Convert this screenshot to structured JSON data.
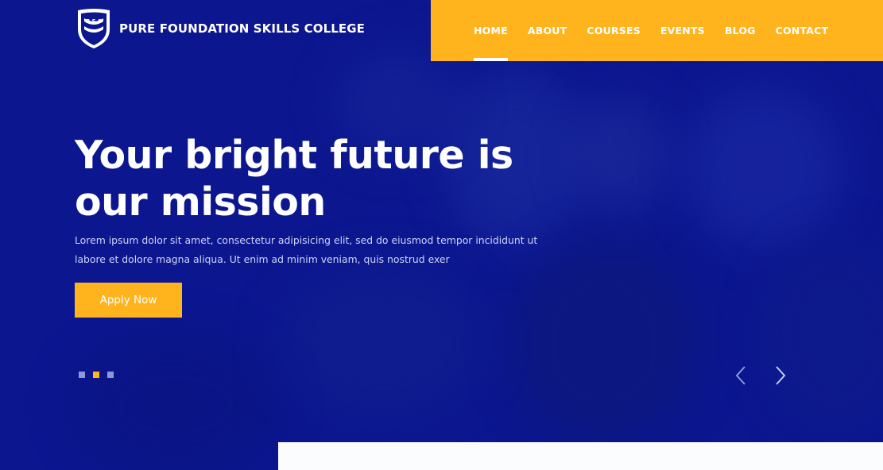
{
  "brand": {
    "name": "PURE FOUNDATION SKILLS COLLEGE",
    "logo_icon": "crest-shield-icon"
  },
  "nav": {
    "items": [
      {
        "label": "HOME",
        "active": true
      },
      {
        "label": "ABOUT",
        "active": false
      },
      {
        "label": "COURSES",
        "active": false
      },
      {
        "label": "EVENTS",
        "active": false
      },
      {
        "label": "BLOG",
        "active": false
      },
      {
        "label": "CONTACT",
        "active": false
      }
    ]
  },
  "hero": {
    "headline_line1": "Your bright future is",
    "headline_line2": "our mission",
    "subtext_line1": "Lorem ipsum dolor sit amet, consectetur adipisicing elit, sed do eiusmod tempor incididunt ut",
    "subtext_line2": "labore et dolore magna aliqua. Ut enim ad minim veniam, quis nostrud exer",
    "cta_label": "Apply Now"
  },
  "slider": {
    "slide_count": 3,
    "active_slide": 2,
    "prev_icon": "chevron-left-icon",
    "next_icon": "chevron-right-icon"
  },
  "colors": {
    "primary_blue": "#0b168f",
    "accent_yellow": "#ffb41e",
    "white": "#ffffff"
  }
}
